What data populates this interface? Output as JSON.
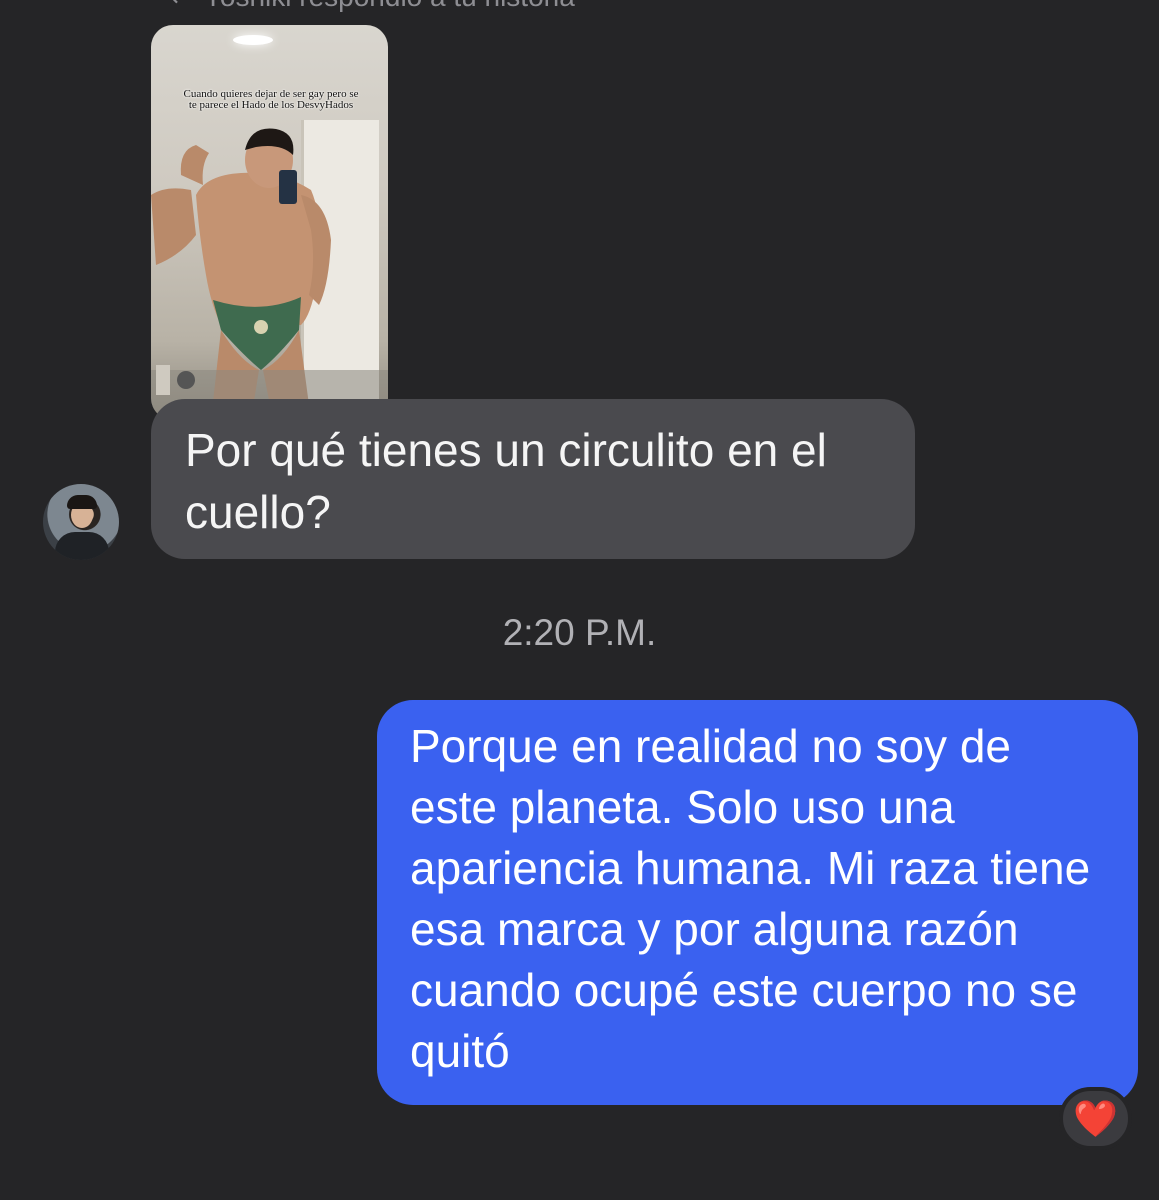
{
  "reply_header": {
    "icon": "reply-arrow-icon",
    "text": "Yoshiki respondió a tu historia"
  },
  "story": {
    "caption": "Cuando quieres dejar de ser gay pero se te parece el Hado de los DesvyHados"
  },
  "messages": [
    {
      "direction": "incoming",
      "text": "Por qué tienes un circulito en el cuello?"
    },
    {
      "direction": "outgoing",
      "text": "Porque en realidad no soy de este planeta. Solo uso una apariencia humana. Mi raza tiene esa marca y por alguna razón cuando ocupé este cuerpo no se quitó",
      "reaction": "❤️"
    }
  ],
  "timestamp": "2:20 P.M.",
  "colors": {
    "background": "#252527",
    "incoming_bubble": "#4a4a4e",
    "outgoing_bubble": "#3a61f0"
  }
}
